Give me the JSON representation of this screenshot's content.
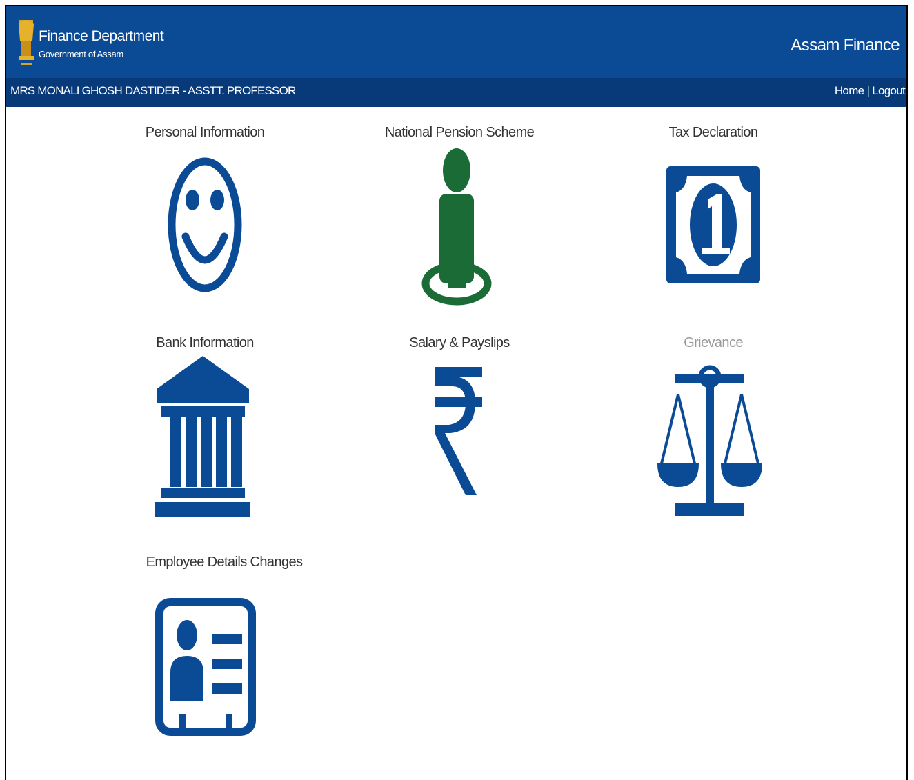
{
  "header": {
    "department_title": "Finance Department",
    "department_subtitle": "Government of Assam",
    "brand": "Assam Finance",
    "emblem_icon": "state-emblem-icon"
  },
  "userbar": {
    "user_name": "MRS MONALI GHOSH DASTIDER - ASSTT. PROFESSOR",
    "home_label": "Home",
    "separator": "|",
    "logout_label": "Logout"
  },
  "tiles": [
    {
      "label": "Personal Information",
      "icon": "smiley-face-icon"
    },
    {
      "label": "National Pension Scheme",
      "icon": "person-standing-icon"
    },
    {
      "label": "Tax Declaration",
      "icon": "currency-note-icon"
    },
    {
      "label": "Bank Information",
      "icon": "bank-building-icon"
    },
    {
      "label": "Salary & Payslips",
      "icon": "rupee-icon"
    },
    {
      "label": "Grievance",
      "icon": "scales-of-justice-icon"
    },
    {
      "label": "Employee Details Changes",
      "icon": "id-card-icon"
    }
  ],
  "colors": {
    "header_bg": "#0b4a95",
    "userbar_bg": "#083a7a",
    "icon_blue": "#0b4a95",
    "icon_green": "#1b6b37"
  }
}
